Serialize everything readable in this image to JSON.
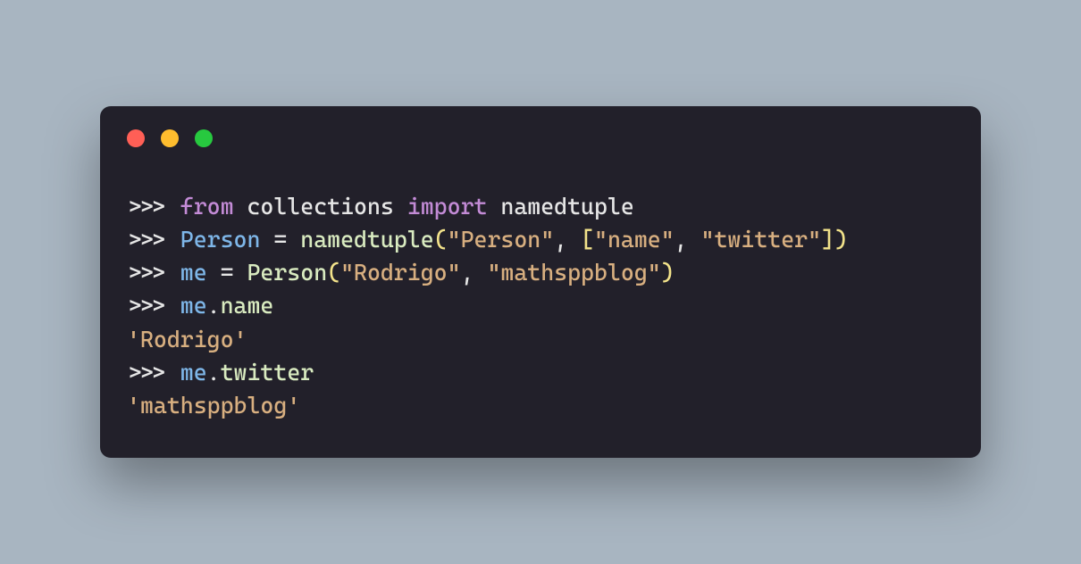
{
  "colors": {
    "page_bg": "#a8b5c1",
    "window_bg": "#22202a",
    "light_red": "#ff5f56",
    "light_yellow": "#ffbd2e",
    "light_green": "#27c93f",
    "default": "#e6e6e6",
    "keyword": "#c38bd6",
    "identifier": "#7eb6e8",
    "function": "#d9ebc0",
    "bracket": "#f2e28a",
    "string": "#d8af80"
  },
  "code": {
    "l1": {
      "p": ">>> ",
      "k1": "from",
      "s1": " ",
      "m1": "collections",
      "s2": " ",
      "k2": "import",
      "s3": " ",
      "m2": "namedtuple"
    },
    "l2": {
      "p": ">>> ",
      "id1": "Person",
      "eq": " = ",
      "fn": "namedtuple",
      "lp": "(",
      "str1": "\"Person\"",
      "cm": ", ",
      "lb": "[",
      "str2": "\"name\"",
      "cm2": ", ",
      "str3": "\"twitter\"",
      "rb": "]",
      "rp": ")"
    },
    "l3": {
      "p": ">>> ",
      "id1": "me",
      "eq": " = ",
      "cls": "Person",
      "lp": "(",
      "str1": "\"Rodrigo\"",
      "cm": ", ",
      "str2": "\"mathsppblog\"",
      "rp": ")"
    },
    "l4": {
      "p": ">>> ",
      "id1": "me",
      "dot": ".",
      "attr": "name"
    },
    "l5": {
      "out": "'Rodrigo'"
    },
    "l6": {
      "p": ">>> ",
      "id1": "me",
      "dot": ".",
      "attr": "twitter"
    },
    "l7": {
      "out": "'mathsppblog'"
    }
  }
}
